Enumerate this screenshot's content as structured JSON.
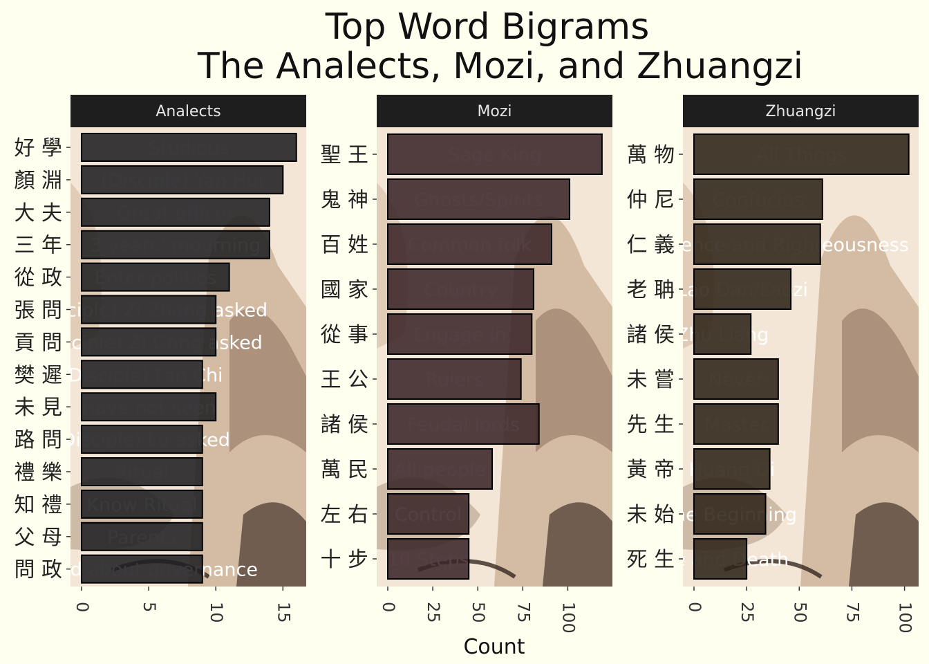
{
  "chart_data": {
    "type": "bar",
    "title_lines": [
      "Top Word Bigrams",
      "The Analects, Mozi, and Zhuangzi"
    ],
    "xlabel": "Count",
    "ylabel": "",
    "orientation": "horizontal",
    "grid": false,
    "legend": "none",
    "panels": [
      {
        "name": "Analects",
        "xlim": [
          0,
          16.8
        ],
        "x_ticks": [
          0,
          5,
          10,
          15
        ],
        "bar_color": "#1f1f22",
        "categories": [
          "好學",
          "顏淵",
          "大夫",
          "三年",
          "從政",
          "張問",
          "貢問",
          "樊遲",
          "未見",
          "路問",
          "禮樂",
          "知禮",
          "父母",
          "問政"
        ],
        "values": [
          16,
          15,
          14,
          14,
          11,
          10,
          10,
          9,
          10,
          9,
          9,
          9,
          9,
          9
        ],
        "labels": [
          "Studious",
          "(Disciple) Yan Hui",
          "Great officer",
          "3 years’ mourning",
          "Enter politics",
          "(Disciple) Zi Zhang asked",
          "(Disciple) Zi Gong asked",
          "(Disciple) Fan Chi",
          "Have not seen",
          "(Disciple) Lu asked",
          "Ritual",
          "Know Ritual",
          "Parents",
          "Asked about governance"
        ]
      },
      {
        "name": "Mozi",
        "xlim": [
          0,
          124
        ],
        "x_ticks": [
          0,
          25,
          50,
          75,
          100
        ],
        "bar_color": "#3a2528",
        "categories": [
          "聖王",
          "鬼神",
          "百姓",
          "國家",
          "從事",
          "王公",
          "諸侯",
          "萬民",
          "左右",
          "十步"
        ],
        "values": [
          119,
          101,
          91,
          81,
          80,
          74,
          84,
          58,
          45,
          45
        ],
        "labels": [
          "Sage King",
          "Ghosts/Spirits",
          "Common folk",
          "Country",
          "Engage in",
          "Rulers",
          "Feudal lords",
          "All people",
          "Control",
          "10 Steps"
        ]
      },
      {
        "name": "Zhuangzi",
        "xlim": [
          0,
          106
        ],
        "x_ticks": [
          0,
          25,
          50,
          75,
          100
        ],
        "bar_color": "#2d2318",
        "categories": [
          "萬物",
          "仲尼",
          "仁義",
          "老聃",
          "諸侯",
          "未嘗",
          "先生",
          "黃帝",
          "未始",
          "死生"
        ],
        "values": [
          102,
          61,
          60,
          46,
          27,
          40,
          40,
          36,
          34,
          25
        ],
        "labels": [
          "All Things",
          "Confucius",
          "Benevolence and Righteousness",
          "Lao Dan/Laozi",
          "Zhu Liang",
          "Never",
          "Master",
          "Huang Di",
          "The Beginning",
          "Life and Death"
        ]
      }
    ]
  }
}
